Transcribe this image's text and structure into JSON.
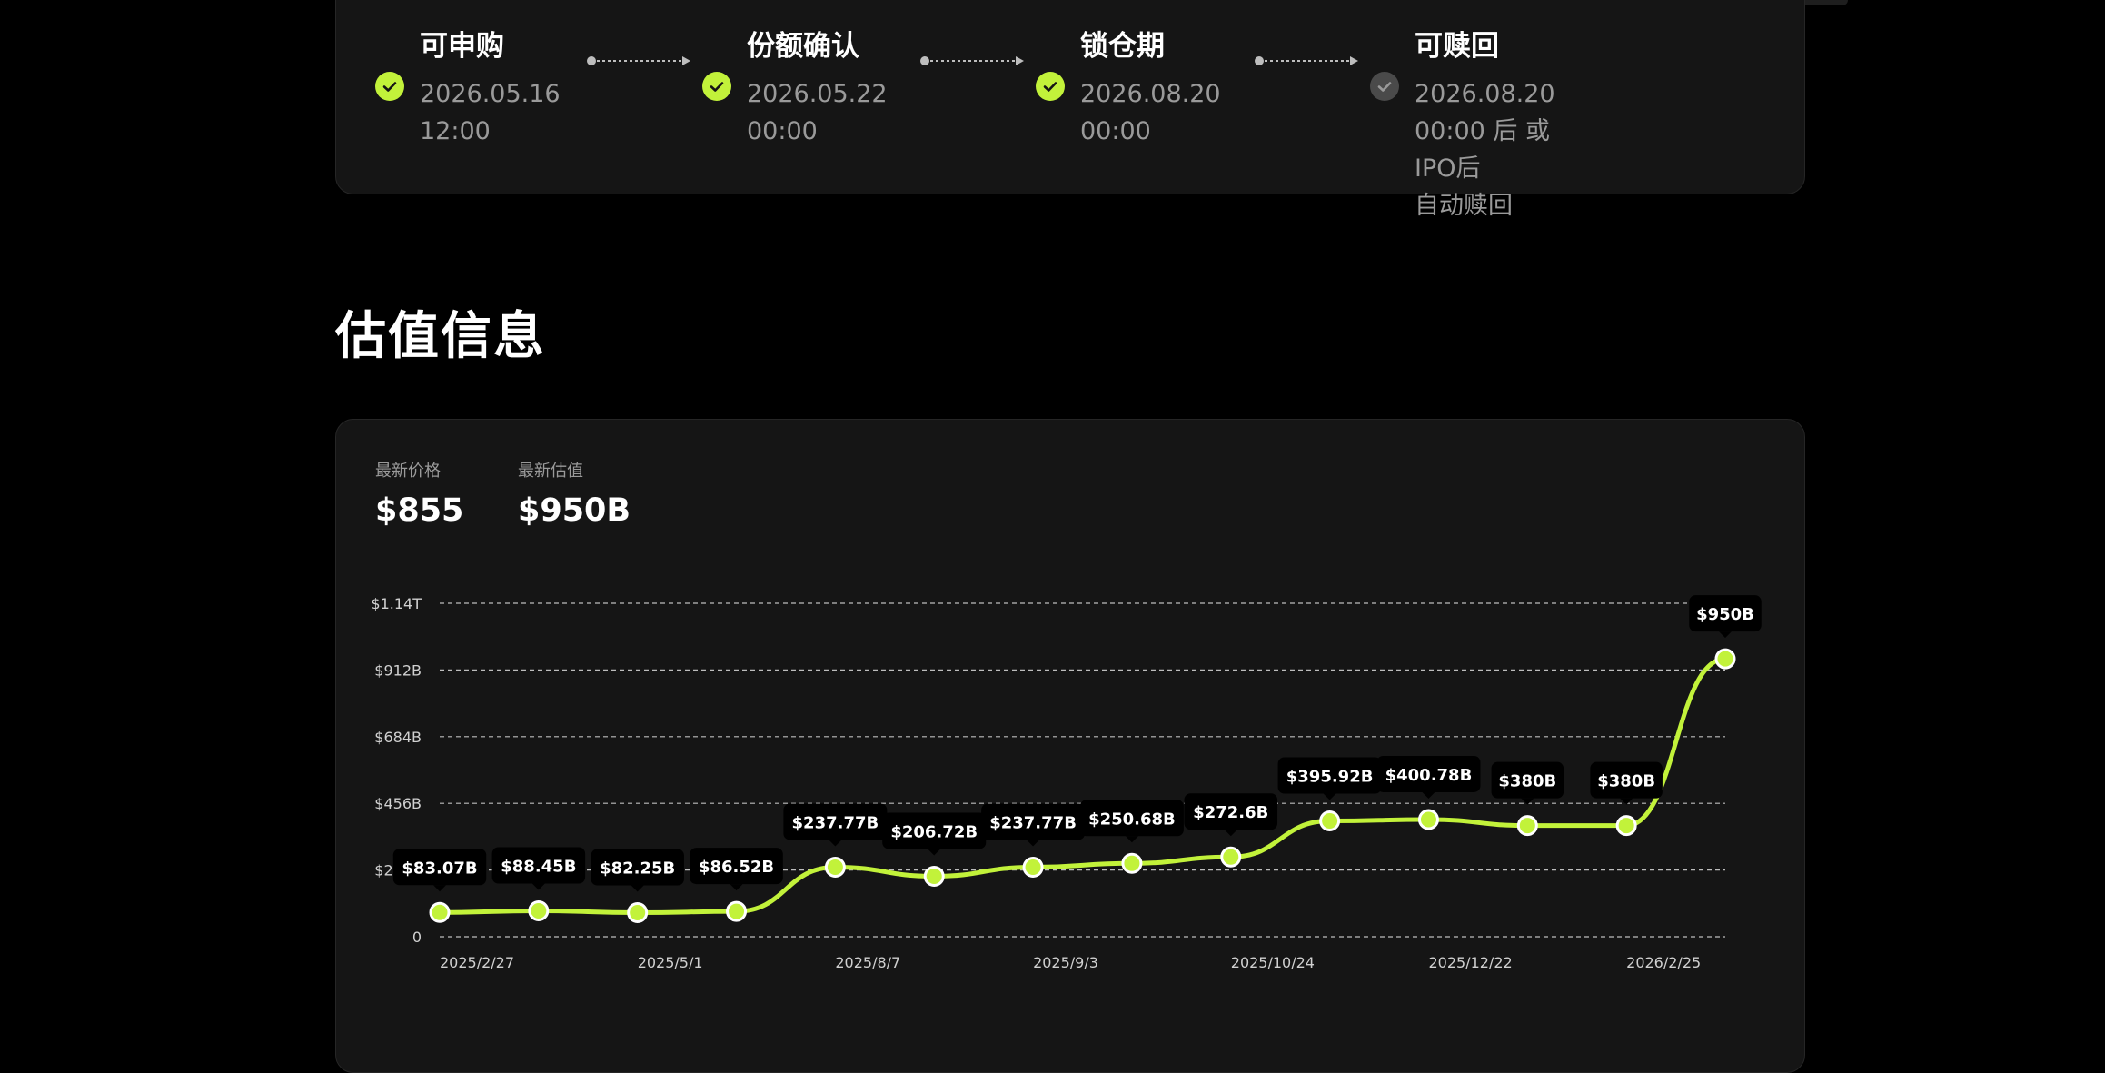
{
  "timeline": {
    "steps": [
      {
        "title": "可申购",
        "date": "2026.05.16\n12:00",
        "status": "done"
      },
      {
        "title": "份额确认",
        "date": "2026.05.22\n00:00",
        "status": "done"
      },
      {
        "title": "锁仓期",
        "date": "2026.08.20\n00:00",
        "status": "done"
      },
      {
        "title": "可赎回",
        "date": "2026.08.20 00:00 后 或 IPO后\n自动赎回",
        "status": "pending"
      }
    ]
  },
  "valuation": {
    "section_title": "估值信息",
    "latest_price_label": "最新价格",
    "latest_price": "$855",
    "latest_valuation_label": "最新估值",
    "latest_valuation": "$950B"
  },
  "colors": {
    "accent": "#c2f23a",
    "pending": "#4a4a4a",
    "card_bg": "#151515",
    "page_bg": "#000000"
  },
  "chart_data": {
    "type": "line",
    "y_ticks": [
      {
        "value": 0,
        "label": "0"
      },
      {
        "value": 228,
        "label": "$228B"
      },
      {
        "value": 456,
        "label": "$456B"
      },
      {
        "value": 684,
        "label": "$684B"
      },
      {
        "value": 912,
        "label": "$912B"
      },
      {
        "value": 1140,
        "label": "$1.14T"
      }
    ],
    "ylim": [
      0,
      1140
    ],
    "x_tick_labels": [
      {
        "index": 0,
        "label": "2025/2/27"
      },
      {
        "index": 2,
        "label": "2025/5/1"
      },
      {
        "index": 4,
        "label": "2025/8/7"
      },
      {
        "index": 6,
        "label": "2025/9/3"
      },
      {
        "index": 8,
        "label": "2025/10/24"
      },
      {
        "index": 10,
        "label": "2025/12/22"
      },
      {
        "index": 12,
        "label": "2026/2/25"
      }
    ],
    "values": [
      83.07,
      88.45,
      82.25,
      86.52,
      237.77,
      206.72,
      237.77,
      250.68,
      272.6,
      395.92,
      400.78,
      380,
      380,
      950
    ],
    "labels": [
      "$83.07B",
      "$88.45B",
      "$82.25B",
      "$86.52B",
      "$237.77B",
      "$206.72B",
      "$237.77B",
      "$250.68B",
      "$272.6B",
      "$395.92B",
      "$400.78B",
      "$380B",
      "$380B",
      "$950B"
    ],
    "grid": true,
    "grid_style": "dashed",
    "line_color": "#c2f23a"
  }
}
